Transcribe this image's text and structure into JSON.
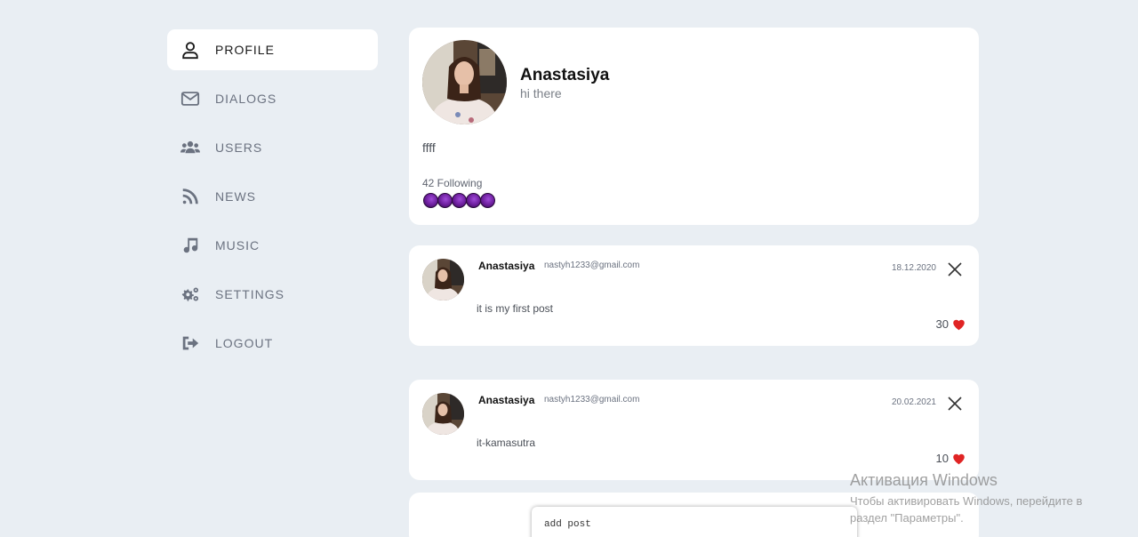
{
  "sidebar": {
    "items": [
      {
        "label": "PROFILE",
        "icon": "user-icon",
        "active": true
      },
      {
        "label": "DIALOGS",
        "icon": "envelope-icon"
      },
      {
        "label": "USERS",
        "icon": "users-icon"
      },
      {
        "label": "NEWS",
        "icon": "rss-icon"
      },
      {
        "label": "MUSIC",
        "icon": "music-note-icon"
      },
      {
        "label": "SETTINGS",
        "icon": "gears-icon"
      },
      {
        "label": "LOGOUT",
        "icon": "logout-icon"
      }
    ]
  },
  "profile": {
    "name": "Anastasiya",
    "status": "hi there",
    "about": "ffff",
    "following": "42 Following"
  },
  "posts": [
    {
      "author": "Anastasiya",
      "email": "nastyh1233@gmail.com",
      "date": "18.12.2020",
      "text": "it is my first post",
      "likes": "30"
    },
    {
      "author": "Anastasiya",
      "email": "nastyh1233@gmail.com",
      "date": "20.02.2021",
      "text": "it-kamasutra",
      "likes": "10"
    }
  ],
  "new_post": {
    "placeholder": "add post"
  },
  "watermark": {
    "title": "Активация Windows",
    "text": "Чтобы активировать Windows, перейдите в раздел \"Параметры\"."
  },
  "colors": {
    "background": "#e9eef3",
    "card": "#ffffff",
    "like_heart": "#e02424",
    "following_avatar": "#8a2ec4"
  }
}
